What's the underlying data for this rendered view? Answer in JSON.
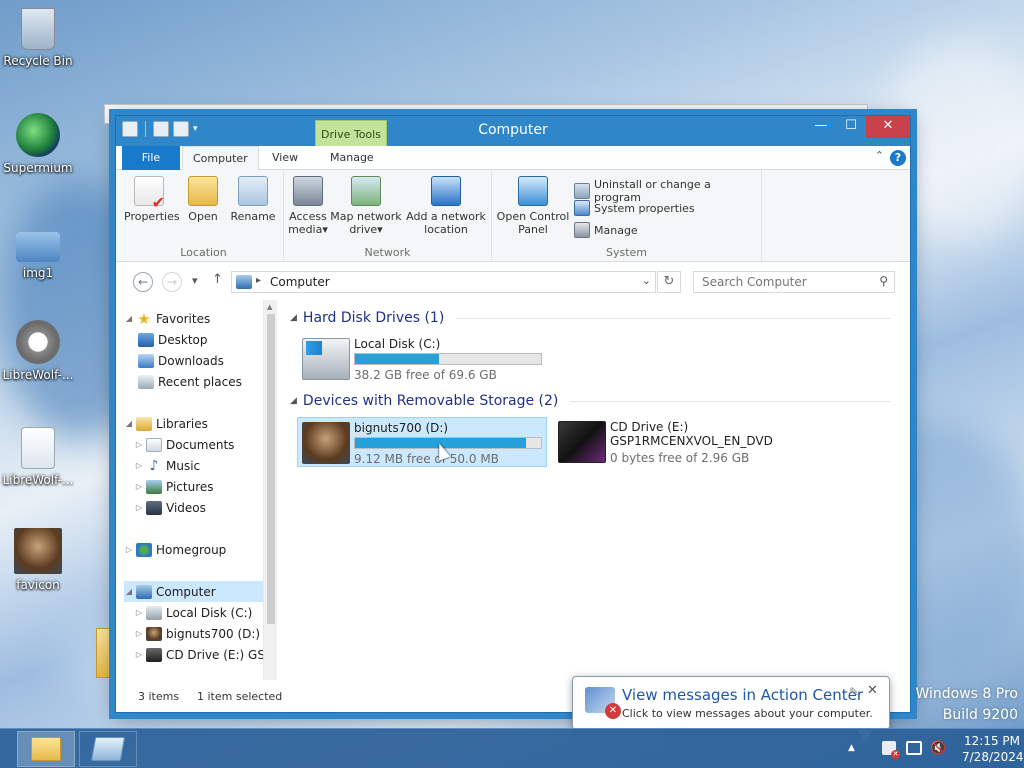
{
  "desktop": {
    "icons": [
      {
        "label": "Recycle Bin"
      },
      {
        "label": "Supermium"
      },
      {
        "label": "img1"
      },
      {
        "label": "LibreWolf-..."
      },
      {
        "label": "LibreWolf-..."
      },
      {
        "label": "favicon"
      }
    ],
    "watermark": {
      "line1": "Windows 8 Pro",
      "line2": "Build 9200"
    }
  },
  "window": {
    "title": "Computer",
    "contextual_tab": "Drive Tools",
    "controls": {
      "minimize": "—",
      "maximize": "☐",
      "close": "✕"
    },
    "tabs": [
      {
        "label": "File"
      },
      {
        "label": "Computer"
      },
      {
        "label": "View"
      },
      {
        "label": "Manage"
      }
    ],
    "help": "?",
    "ribbon_collapse": "⌃"
  },
  "ribbon": {
    "location": {
      "label": "Location",
      "buttons": [
        {
          "label": "Properties",
          "icon": "properties-icon"
        },
        {
          "label": "Open",
          "icon": "open-folder-icon"
        },
        {
          "label": "Rename",
          "icon": "rename-icon"
        }
      ]
    },
    "network": {
      "label": "Network",
      "buttons": [
        {
          "label_1": "Access",
          "label_2": "media",
          "dropdown": "▾",
          "icon": "access-media-icon"
        },
        {
          "label_1": "Map network",
          "label_2": "drive",
          "dropdown": "▾",
          "icon": "map-drive-icon"
        },
        {
          "label_1": "Add a network",
          "label_2": "location",
          "icon": "add-network-location-icon"
        }
      ]
    },
    "system": {
      "label": "System",
      "open_cp": {
        "label_1": "Open Control",
        "label_2": "Panel",
        "icon": "control-panel-icon"
      },
      "items": [
        {
          "label": "Uninstall or change a program",
          "icon": "uninstall-icon"
        },
        {
          "label": "System properties",
          "icon": "system-properties-icon"
        },
        {
          "label": "Manage",
          "icon": "manage-icon"
        }
      ]
    }
  },
  "address": {
    "back": "←",
    "forward": "→",
    "recent": "▾",
    "up": "↑",
    "crumb_sep": "▸",
    "path": "Computer",
    "dropdown": "⌄",
    "refresh": "↻",
    "search_placeholder": "Search Computer",
    "search_icon": "⚲"
  },
  "navpane": {
    "favorites": {
      "label": "Favorites",
      "items": [
        "Desktop",
        "Downloads",
        "Recent places"
      ]
    },
    "libraries": {
      "label": "Libraries",
      "items": [
        "Documents",
        "Music",
        "Pictures",
        "Videos"
      ]
    },
    "homegroup": {
      "label": "Homegroup"
    },
    "computer": {
      "label": "Computer",
      "items": [
        "Local Disk (C:)",
        "bignuts700 (D:)",
        "CD Drive (E:) GSP"
      ]
    }
  },
  "content": {
    "hdd_section": "Hard Disk Drives (1)",
    "removable_section": "Devices with Removable Storage (2)",
    "drives": [
      {
        "name": "Local Disk (C:)",
        "free_text": "38.2 GB free of 69.6 GB",
        "used_fraction": 0.45
      },
      {
        "name": "bignuts700 (D:)",
        "free_text": "9.12 MB free of 50.0 MB",
        "used_fraction": 0.92
      },
      {
        "name": "CD Drive (E:)",
        "sub": "GSP1RMCENXVOL_EN_DVD",
        "free_text": "0 bytes free of 2.96 GB"
      }
    ]
  },
  "status": {
    "items": "3 items",
    "selected": "1 item selected"
  },
  "balloon": {
    "title": "View messages in Action Center",
    "subtitle": "Click to view messages about your computer.",
    "pin": "✎",
    "close": "✕"
  },
  "taskbar": {
    "clock_time": "12:15 PM",
    "clock_date": "7/28/2024",
    "tray_arrow": "▲",
    "volume": "🔇"
  }
}
